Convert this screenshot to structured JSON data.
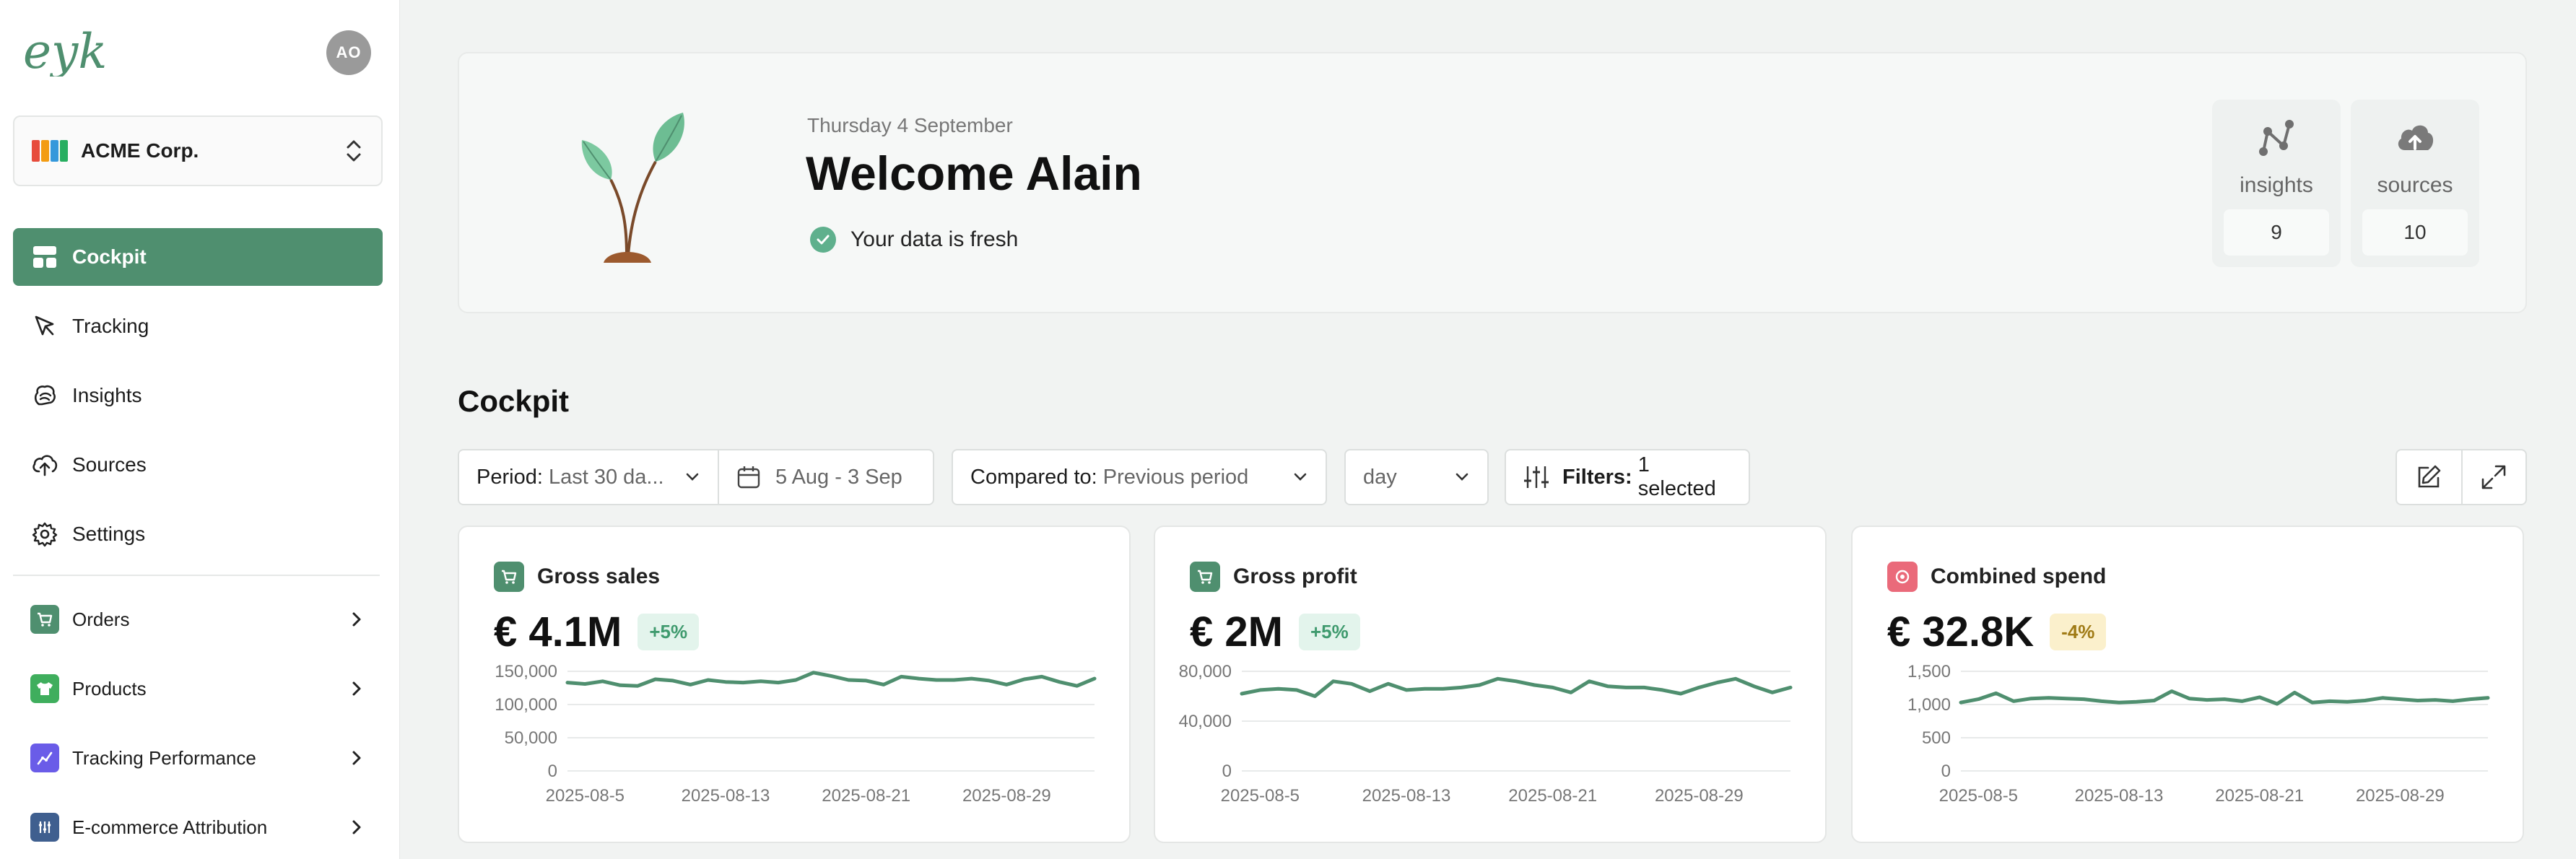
{
  "app": {
    "logo_text": "eyk",
    "user_initials": "AO",
    "organization": "ACME Corp."
  },
  "sidebar": {
    "nav": [
      {
        "label": "Cockpit",
        "icon": "layout-icon",
        "active": true
      },
      {
        "label": "Tracking",
        "icon": "cursor-icon"
      },
      {
        "label": "Insights",
        "icon": "brain-icon"
      },
      {
        "label": "Sources",
        "icon": "cloud-upload-icon"
      },
      {
        "label": "Settings",
        "icon": "gear-icon"
      }
    ],
    "groups": [
      {
        "label": "Orders",
        "icon": "cart-icon",
        "color": "#4f8f6f"
      },
      {
        "label": "Products",
        "icon": "shirt-icon",
        "color": "#3fae5d"
      },
      {
        "label": "Tracking Performance",
        "icon": "chart-icon",
        "color": "#6a5ce8"
      },
      {
        "label": "E-commerce Attribution",
        "icon": "grid-icon",
        "color": "#3f5f8f"
      }
    ]
  },
  "welcome": {
    "date": "Thursday 4 September",
    "title": "Welcome Alain",
    "status": "Your data is fresh",
    "stats": [
      {
        "label": "insights",
        "value": "9",
        "icon": "nodes-icon"
      },
      {
        "label": "sources",
        "value": "10",
        "icon": "cloud-upload-icon"
      }
    ]
  },
  "cockpit": {
    "title": "Cockpit",
    "controls": {
      "period_label": "Period:",
      "period_value": "Last 30 da...",
      "date_range": "5 Aug - 3 Sep",
      "compare_label": "Compared to:",
      "compare_value": "Previous period",
      "granularity": "day",
      "filters_label": "Filters:",
      "filters_value": "1 selected"
    },
    "cards": [
      {
        "title": "Gross sales",
        "value": "€ 4.1M",
        "change": "+5%",
        "trend": "up",
        "icon": "cart-icon",
        "color": "#4f8f6f"
      },
      {
        "title": "Gross profit",
        "value": "€ 2M",
        "change": "+5%",
        "trend": "up",
        "icon": "cart-icon",
        "color": "#4f8f6f"
      },
      {
        "title": "Combined spend",
        "value": "€ 32.8K",
        "change": "-4%",
        "trend": "down",
        "icon": "target-icon",
        "color": "#ea6a7a"
      }
    ]
  },
  "chart_data": [
    {
      "type": "line",
      "title": "Gross sales",
      "x_ticks": [
        "2025-08-5",
        "2025-08-13",
        "2025-08-21",
        "2025-08-29"
      ],
      "y_ticks": [
        "0",
        "50,000",
        "100,000",
        "150,000"
      ],
      "ylim": [
        0,
        150000
      ],
      "x": [
        "2025-08-04",
        "2025-08-05",
        "2025-08-06",
        "2025-08-07",
        "2025-08-08",
        "2025-08-09",
        "2025-08-10",
        "2025-08-11",
        "2025-08-12",
        "2025-08-13",
        "2025-08-14",
        "2025-08-15",
        "2025-08-16",
        "2025-08-17",
        "2025-08-18",
        "2025-08-19",
        "2025-08-20",
        "2025-08-21",
        "2025-08-22",
        "2025-08-23",
        "2025-08-24",
        "2025-08-25",
        "2025-08-26",
        "2025-08-27",
        "2025-08-28",
        "2025-08-29",
        "2025-08-30",
        "2025-08-31",
        "2025-09-01",
        "2025-09-02",
        "2025-09-03"
      ],
      "series": [
        {
          "values": [
            133000,
            131000,
            135000,
            129000,
            128000,
            138000,
            136000,
            130000,
            137000,
            134000,
            133000,
            135000,
            133000,
            137000,
            148000,
            143000,
            137000,
            136000,
            130000,
            142000,
            139000,
            137000,
            137000,
            139000,
            136000,
            130000,
            138000,
            142000,
            134000,
            128000,
            139000
          ]
        }
      ],
      "color": "#4f8f6f"
    },
    {
      "type": "line",
      "title": "Gross profit",
      "x_ticks": [
        "2025-08-5",
        "2025-08-13",
        "2025-08-21",
        "2025-08-29"
      ],
      "y_ticks": [
        "0",
        "40,000",
        "80,000"
      ],
      "ylim": [
        0,
        80000
      ],
      "x": [
        "2025-08-04",
        "2025-08-05",
        "2025-08-06",
        "2025-08-07",
        "2025-08-08",
        "2025-08-09",
        "2025-08-10",
        "2025-08-11",
        "2025-08-12",
        "2025-08-13",
        "2025-08-14",
        "2025-08-15",
        "2025-08-16",
        "2025-08-17",
        "2025-08-18",
        "2025-08-19",
        "2025-08-20",
        "2025-08-21",
        "2025-08-22",
        "2025-08-23",
        "2025-08-24",
        "2025-08-25",
        "2025-08-26",
        "2025-08-27",
        "2025-08-28",
        "2025-08-29",
        "2025-08-30",
        "2025-08-31",
        "2025-09-01",
        "2025-09-02",
        "2025-09-03"
      ],
      "series": [
        {
          "values": [
            62000,
            65000,
            66000,
            65000,
            60000,
            72000,
            70000,
            64000,
            70000,
            65000,
            66000,
            66000,
            67000,
            69000,
            74000,
            72000,
            69000,
            67000,
            63000,
            72000,
            68000,
            67000,
            67000,
            65000,
            62000,
            67000,
            71000,
            74000,
            68000,
            63000,
            67000
          ]
        }
      ],
      "color": "#4f8f6f"
    },
    {
      "type": "line",
      "title": "Combined spend",
      "x_ticks": [
        "2025-08-5",
        "2025-08-13",
        "2025-08-21",
        "2025-08-29"
      ],
      "y_ticks": [
        "0",
        "500",
        "1,000",
        "1,500"
      ],
      "ylim": [
        0,
        1500
      ],
      "x": [
        "2025-08-04",
        "2025-08-05",
        "2025-08-06",
        "2025-08-07",
        "2025-08-08",
        "2025-08-09",
        "2025-08-10",
        "2025-08-11",
        "2025-08-12",
        "2025-08-13",
        "2025-08-14",
        "2025-08-15",
        "2025-08-16",
        "2025-08-17",
        "2025-08-18",
        "2025-08-19",
        "2025-08-20",
        "2025-08-21",
        "2025-08-22",
        "2025-08-23",
        "2025-08-24",
        "2025-08-25",
        "2025-08-26",
        "2025-08-27",
        "2025-08-28",
        "2025-08-29",
        "2025-08-30",
        "2025-08-31",
        "2025-09-01",
        "2025-09-02",
        "2025-09-03"
      ],
      "series": [
        {
          "values": [
            1030,
            1080,
            1170,
            1050,
            1090,
            1100,
            1090,
            1080,
            1050,
            1030,
            1040,
            1060,
            1200,
            1090,
            1070,
            1080,
            1050,
            1110,
            1010,
            1180,
            1030,
            1050,
            1040,
            1060,
            1100,
            1080,
            1060,
            1070,
            1050,
            1080,
            1100
          ]
        }
      ],
      "color": "#4f8f6f"
    }
  ]
}
